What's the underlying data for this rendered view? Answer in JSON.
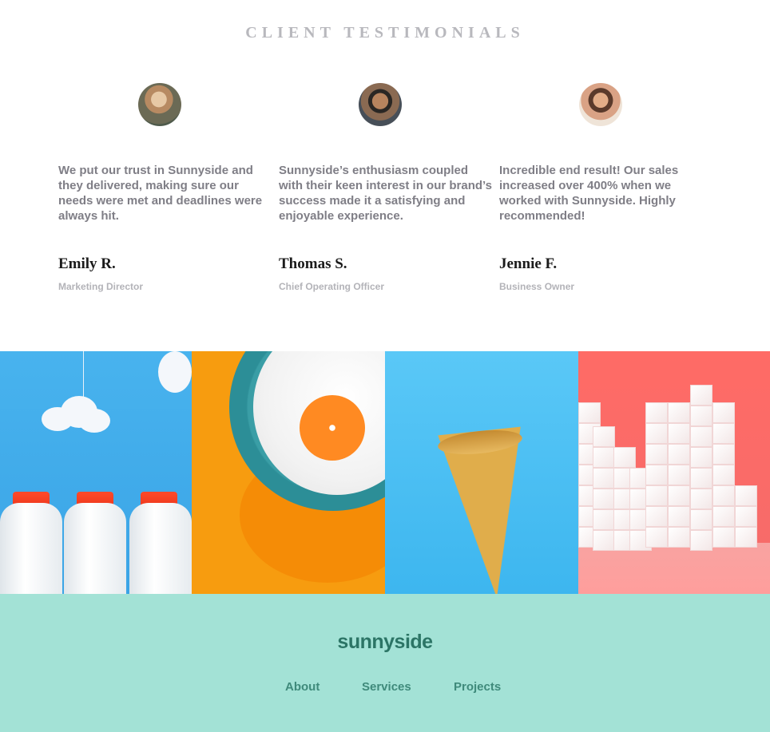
{
  "testimonials": {
    "heading": "CLIENT TESTIMONIALS",
    "items": [
      {
        "quote": "We put our trust in Sunnyside and they delivered, making sure our needs were met and deadlines were always hit.",
        "name": "Emily R.",
        "role": "Marketing Director"
      },
      {
        "quote": "Sunnyside’s enthusiasm coupled with their keen interest in our brand’s success made it a satisfying and enjoyable experience.",
        "name": "Thomas S.",
        "role": "Chief Operating Officer"
      },
      {
        "quote": "Incredible end result! Our sales increased over 400% when we worked with Sunnyside. Highly recommended!",
        "name": "Jennie F.",
        "role": "Business Owner"
      }
    ]
  },
  "gallery": {
    "colors": {
      "milk": "#48b3ee",
      "orange": "#f79c0f",
      "cone": "#5ac8f7",
      "sugar": "#ff6b66"
    }
  },
  "footer": {
    "logo": "sunnyside",
    "nav": [
      {
        "label": "About"
      },
      {
        "label": "Services"
      },
      {
        "label": "Projects"
      }
    ],
    "background": "#a3e2d6"
  }
}
